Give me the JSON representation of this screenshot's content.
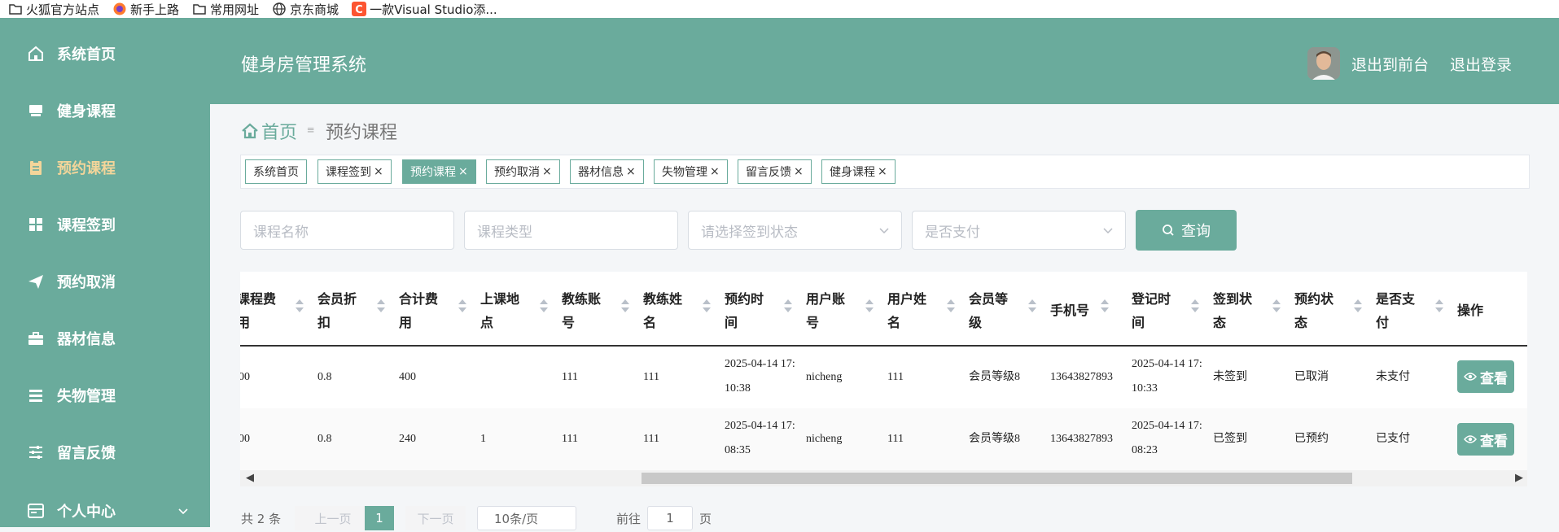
{
  "bookmarks": [
    {
      "label": "火狐官方站点",
      "icon": "folder-icon"
    },
    {
      "label": "新手上路",
      "icon": "firefox-icon"
    },
    {
      "label": "常用网址",
      "icon": "folder-icon"
    },
    {
      "label": "京东商城",
      "icon": "globe-icon"
    },
    {
      "label": "一款Visual Studio添...",
      "icon": "csdn-icon"
    }
  ],
  "sidebar": {
    "items": [
      {
        "label": "系统首页",
        "icon": "home-icon"
      },
      {
        "label": "健身课程",
        "icon": "course-icon"
      },
      {
        "label": "预约课程",
        "icon": "clipboard-icon"
      },
      {
        "label": "课程签到",
        "icon": "grid-icon"
      },
      {
        "label": "预约取消",
        "icon": "send-icon"
      },
      {
        "label": "器材信息",
        "icon": "briefcase-icon"
      },
      {
        "label": "失物管理",
        "icon": "list-icon"
      },
      {
        "label": "留言反馈",
        "icon": "sliders-icon"
      },
      {
        "label": "个人中心",
        "icon": "user-card-icon"
      }
    ],
    "active_index": 2
  },
  "header": {
    "title": "健身房管理系统",
    "to_front": "退出到前台",
    "logout": "退出登录"
  },
  "breadcrumb": {
    "home": "首页",
    "separator": "≡",
    "current": "预约课程"
  },
  "tags": [
    {
      "label": "系统首页",
      "closable": false
    },
    {
      "label": "课程签到",
      "closable": true
    },
    {
      "label": "预约课程",
      "closable": true
    },
    {
      "label": "预约取消",
      "closable": true
    },
    {
      "label": "器材信息",
      "closable": true
    },
    {
      "label": "失物管理",
      "closable": true
    },
    {
      "label": "留言反馈",
      "closable": true
    },
    {
      "label": "健身课程",
      "closable": true
    }
  ],
  "close_glyph": "×",
  "search": {
    "course_name_placeholder": "课程名称",
    "course_type_placeholder": "课程类型",
    "signin_status_placeholder": "请选择签到状态",
    "paid_placeholder": "是否支付",
    "query_label": "查询"
  },
  "table": {
    "columns": [
      {
        "l1": "课程费",
        "l2": "用",
        "sortable": true
      },
      {
        "l1": "会员折",
        "l2": "扣",
        "sortable": true
      },
      {
        "l1": "合计费",
        "l2": "用",
        "sortable": true
      },
      {
        "l1": "上课地",
        "l2": "点",
        "sortable": true
      },
      {
        "l1": "教练账",
        "l2": "号",
        "sortable": true
      },
      {
        "l1": "教练姓",
        "l2": "名",
        "sortable": true
      },
      {
        "l1": "预约时",
        "l2": "间",
        "sortable": true
      },
      {
        "l1": "用户账",
        "l2": "号",
        "sortable": true
      },
      {
        "l1": "用户姓",
        "l2": "名",
        "sortable": true
      },
      {
        "l1": "会员等",
        "l2": "级",
        "sortable": true
      },
      {
        "l1": "手机号",
        "l2": "",
        "sortable": true
      },
      {
        "l1": "登记时",
        "l2": "间",
        "sortable": true
      },
      {
        "l1": "签到状",
        "l2": "态",
        "sortable": true
      },
      {
        "l1": "预约状",
        "l2": "态",
        "sortable": true
      },
      {
        "l1": "是否支",
        "l2": "付",
        "sortable": true
      },
      {
        "l1": "操作",
        "l2": "",
        "sortable": false
      }
    ],
    "rows": [
      {
        "fee": "00",
        "discount": "0.8",
        "total": "400",
        "location": "",
        "coach_account": "111",
        "coach_name": "111",
        "booking_time_1": "2025-04-14 17:",
        "booking_time_2": "10:38",
        "user_account": "nicheng",
        "user_name": "111",
        "member_level": "会员等级8",
        "phone": "13643827893",
        "register_time_1": "2025-04-14 17:",
        "register_time_2": "10:33",
        "signin_status": "未签到",
        "booking_status": "已取消",
        "paid": "未支付"
      },
      {
        "fee": "00",
        "discount": "0.8",
        "total": "240",
        "location": "1",
        "coach_account": "111",
        "coach_name": "111",
        "booking_time_1": "2025-04-14 17:",
        "booking_time_2": "08:35",
        "user_account": "nicheng",
        "user_name": "111",
        "member_level": "会员等级8",
        "phone": "13643827893",
        "register_time_1": "2025-04-14 17:",
        "register_time_2": "08:23",
        "signin_status": "已签到",
        "booking_status": "已预约",
        "paid": "已支付"
      }
    ],
    "view_label": "查看"
  },
  "pagination": {
    "total_text": "共 2 条",
    "prev": "上一页",
    "current_page": "1",
    "next": "下一页",
    "page_size": "10条/页",
    "goto_prefix": "前往",
    "goto_value": "1",
    "goto_suffix": "页"
  },
  "colors": {
    "accent": "#6aab9c",
    "active_nav": "#f3d59a"
  }
}
